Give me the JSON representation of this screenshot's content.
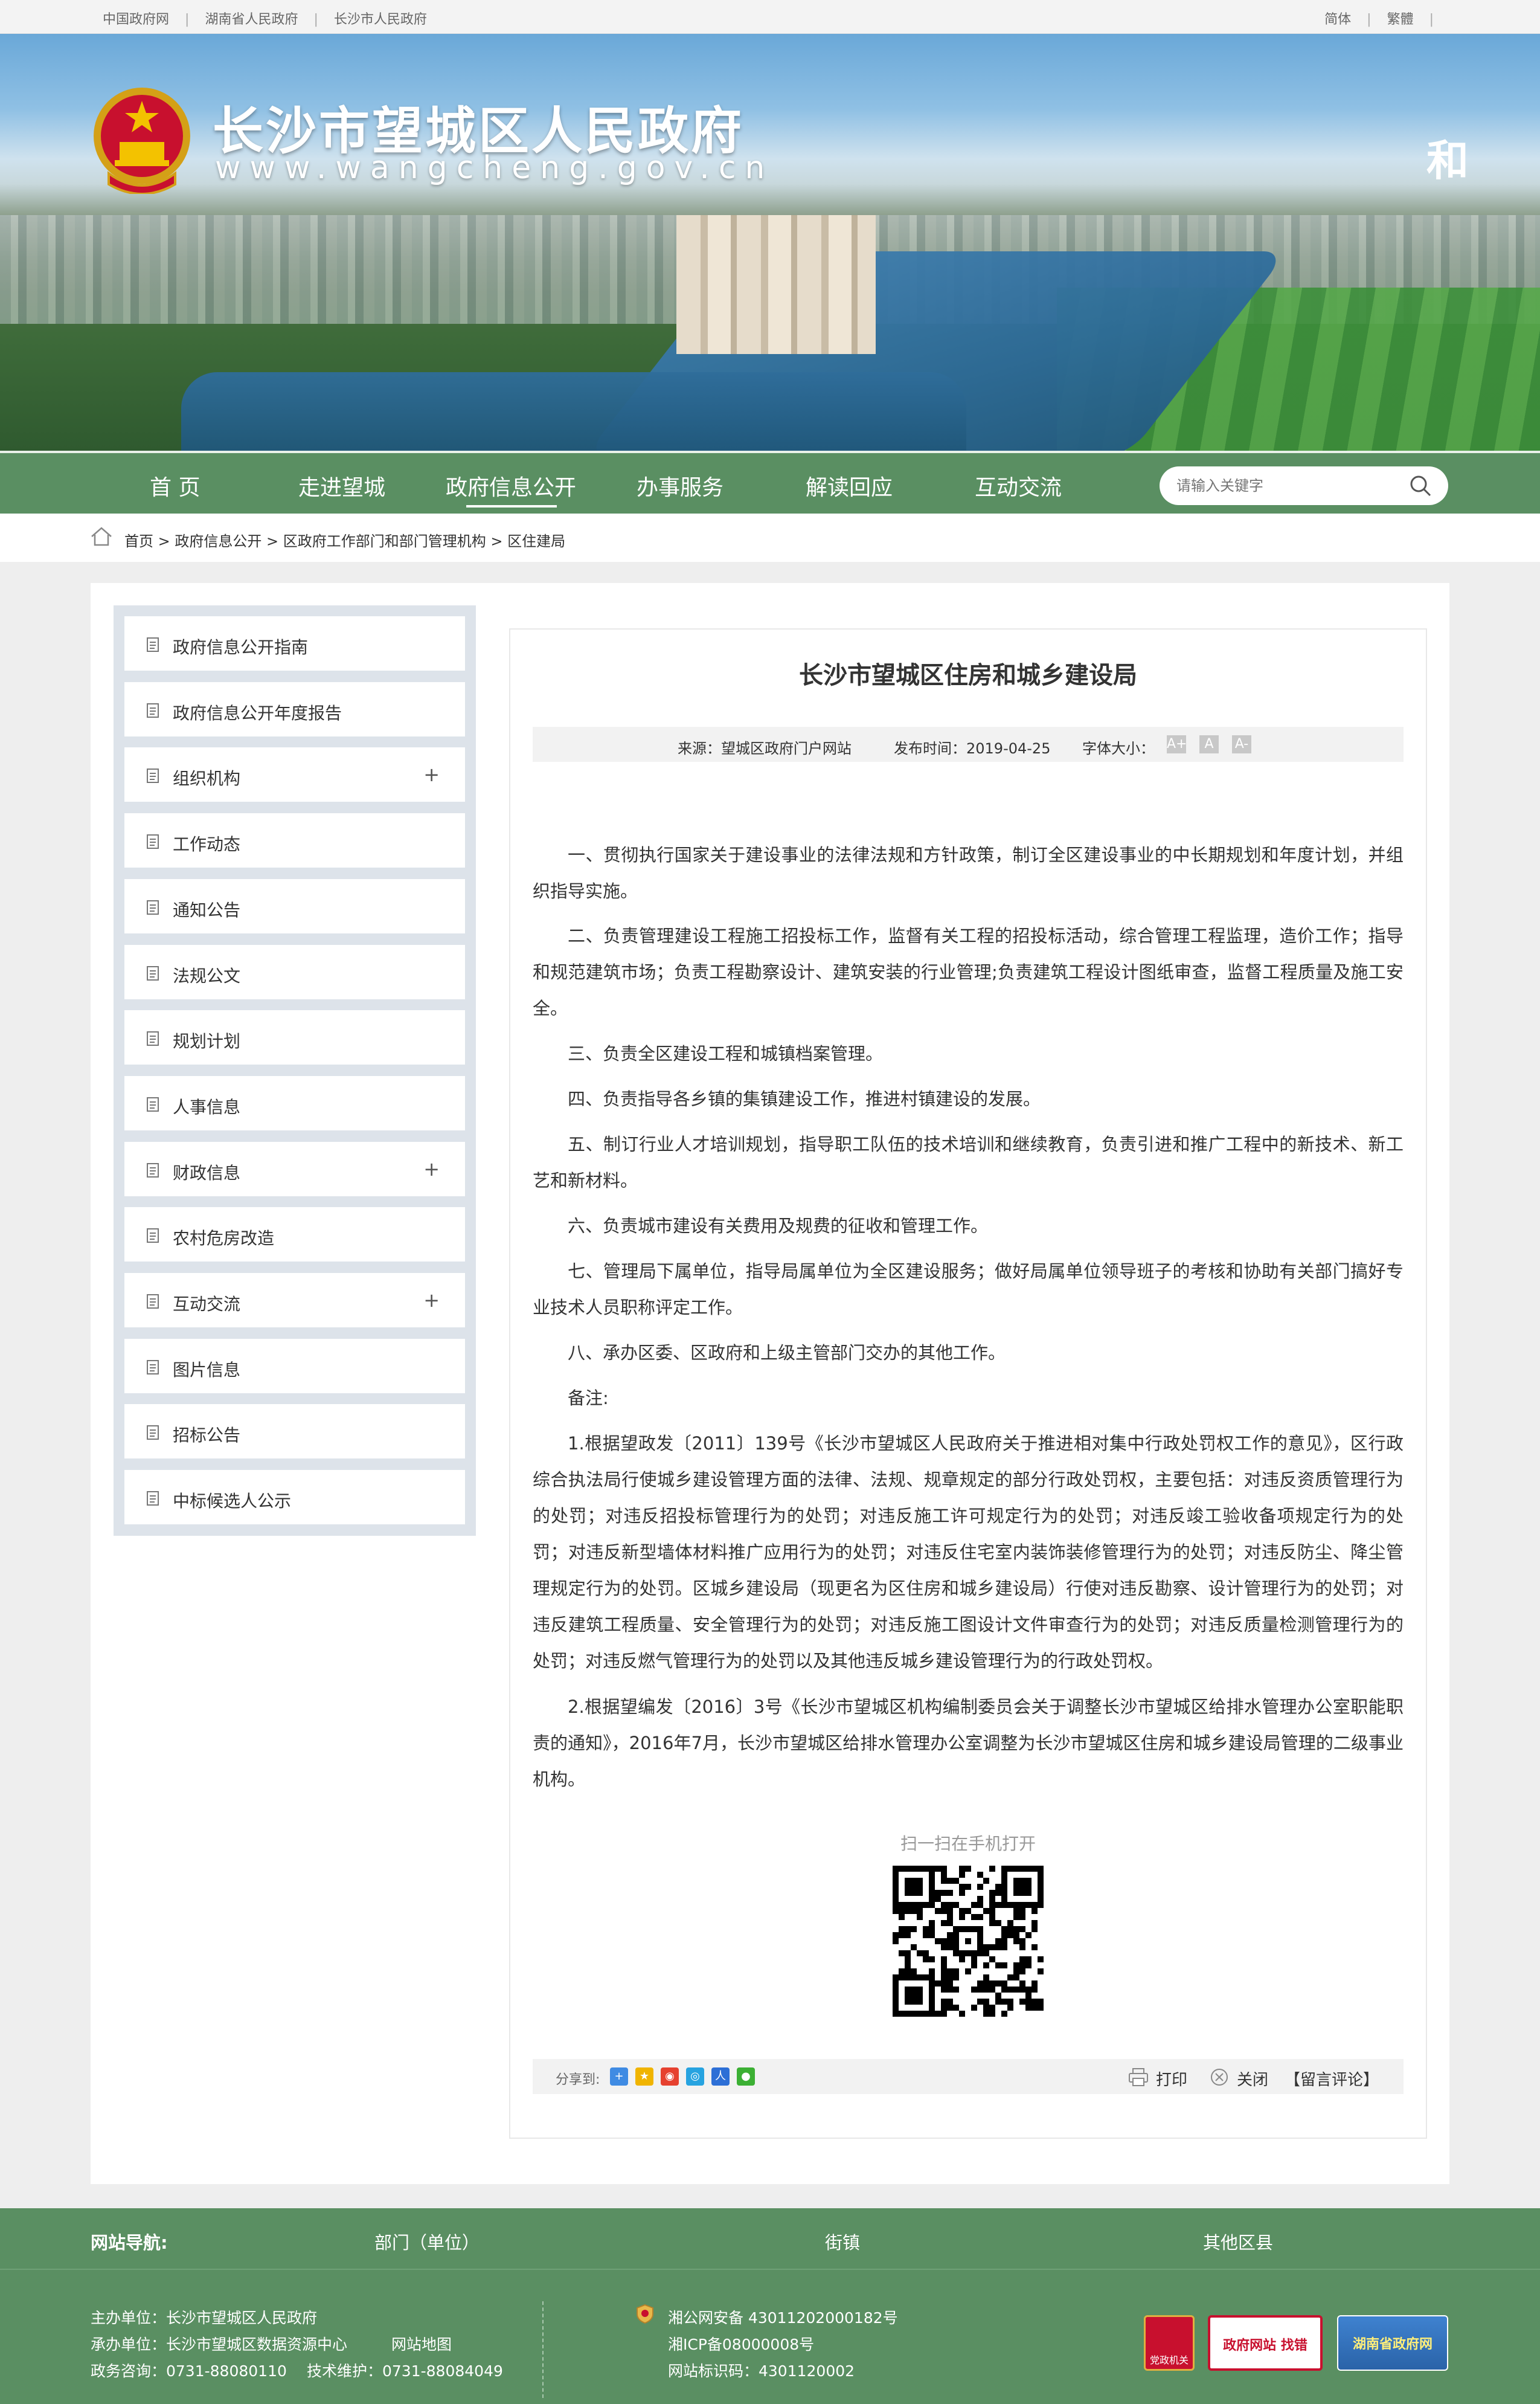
{
  "topbar": {
    "links": [
      "中国政府网",
      "湖南省人民政府",
      "长沙市人民政府"
    ],
    "lang_simplified": "简体",
    "lang_traditional": "繁體"
  },
  "header": {
    "site_title": "长沙市望城区人民政府",
    "site_url": "www.wangcheng.gov.cn",
    "banner_char": "和"
  },
  "nav": {
    "items": [
      "首 页",
      "走进望城",
      "政府信息公开",
      "办事服务",
      "解读回应",
      "互动交流"
    ],
    "active": "政府信息公开",
    "search_placeholder": "请输入关键字"
  },
  "breadcrumb": {
    "path": "首页 > 政府信息公开 > 区政府工作部门和部门管理机构 > 区住建局"
  },
  "sidebar": {
    "items": [
      {
        "label": "政府信息公开指南",
        "expandable": ""
      },
      {
        "label": "政府信息公开年度报告",
        "expandable": ""
      },
      {
        "label": "组织机构",
        "expandable": "+"
      },
      {
        "label": "工作动态",
        "expandable": ""
      },
      {
        "label": "通知公告",
        "expandable": ""
      },
      {
        "label": "法规公文",
        "expandable": ""
      },
      {
        "label": "规划计划",
        "expandable": ""
      },
      {
        "label": "人事信息",
        "expandable": ""
      },
      {
        "label": "财政信息",
        "expandable": "+"
      },
      {
        "label": "农村危房改造",
        "expandable": ""
      },
      {
        "label": "互动交流",
        "expandable": "+"
      },
      {
        "label": "图片信息",
        "expandable": ""
      },
      {
        "label": "招标公告",
        "expandable": ""
      },
      {
        "label": "中标候选人公示",
        "expandable": ""
      }
    ]
  },
  "article": {
    "title": "长沙市望城区住房和城乡建设局",
    "source": "来源：望城区政府门户网站",
    "publish_time": "发布时间：2019-04-25",
    "font_size_label": "字体大小：",
    "font_sizes": [
      "A+",
      "A",
      "A-"
    ],
    "paragraphs": [
      "一、贯彻执行国家关于建设事业的法律法规和方针政策，制订全区建设事业的中长期规划和年度计划，并组织指导实施。",
      "二、负责管理建设工程施工招投标工作，监督有关工程的招投标活动，综合管理工程监理，造价工作；指导和规范建筑市场；负责工程勘察设计、建筑安装的行业管理;负责建筑工程设计图纸审查，监督工程质量及施工安全。",
      "三、负责全区建设工程和城镇档案管理。",
      "四、负责指导各乡镇的集镇建设工作，推进村镇建设的发展。",
      "五、制订行业人才培训规划，指导职工队伍的技术培训和继续教育，负责引进和推广工程中的新技术、新工艺和新材料。",
      "六、负责城市建设有关费用及规费的征收和管理工作。",
      "七、管理局下属单位，指导局属单位为全区建设服务；做好局属单位领导班子的考核和协助有关部门搞好专业技术人员职称评定工作。",
      "八、承办区委、区政府和上级主管部门交办的其他工作。",
      "备注:",
      "1.根据望政发〔2011〕139号《长沙市望城区人民政府关于推进相对集中行政处罚权工作的意见》，区行政综合执法局行使城乡建设管理方面的法律、法规、规章规定的部分行政处罚权，主要包括：对违反资质管理行为的处罚；对违反招投标管理行为的处罚；对违反施工许可规定行为的处罚；对违反竣工验收备项规定行为的处罚；对违反新型墙体材料推广应用行为的处罚；对违反住宅室内装饰装修管理行为的处罚；对违反防尘、降尘管理规定行为的处罚。区城乡建设局（现更名为区住房和城乡建设局）行使对违反勘察、设计管理行为的处罚；对违反建筑工程质量、安全管理行为的处罚；对违反施工图设计文件审查行为的处罚；对违反质量检测管理行为的处罚；对违反燃气管理行为的处罚以及其他违反城乡建设管理行为的行政处罚权。",
      "2.根据望编发〔2016〕3号《长沙市望城区机构编制委员会关于调整长沙市望城区给排水管理办公室职能职责的通知》，2016年7月，长沙市望城区给排水管理办公室调整为长沙市望城区住房和城乡建设局管理的二级事业机构。"
    ],
    "qr_label": "扫一扫在手机打开",
    "share_label": "分享到:",
    "print_label": "打印",
    "close_label": "关闭",
    "comment_label": "【留言评论】"
  },
  "footer_nav": {
    "title": "网站导航:",
    "items": [
      "部门（单位）",
      "街镇",
      "其他区县"
    ]
  },
  "footer": {
    "host": "主办单位：长沙市望城区人民政府",
    "organizer": "承办单位：长沙市望城区数据资源中心",
    "sitemap": "网站地图",
    "consult": "政务咨询：0731-88080110",
    "support": "技术维护：0731-88084049",
    "police_record": "湘公网安备 43011202000182号",
    "icp": "湘ICP备08000008号",
    "site_id": "网站标识码：4301120002",
    "badges": [
      "党政机关",
      "政府网站 找错",
      "湖南省政府网"
    ]
  },
  "colors": {
    "nav_green": "#5a8f62",
    "sidebar_bg": "#dde3ea"
  }
}
